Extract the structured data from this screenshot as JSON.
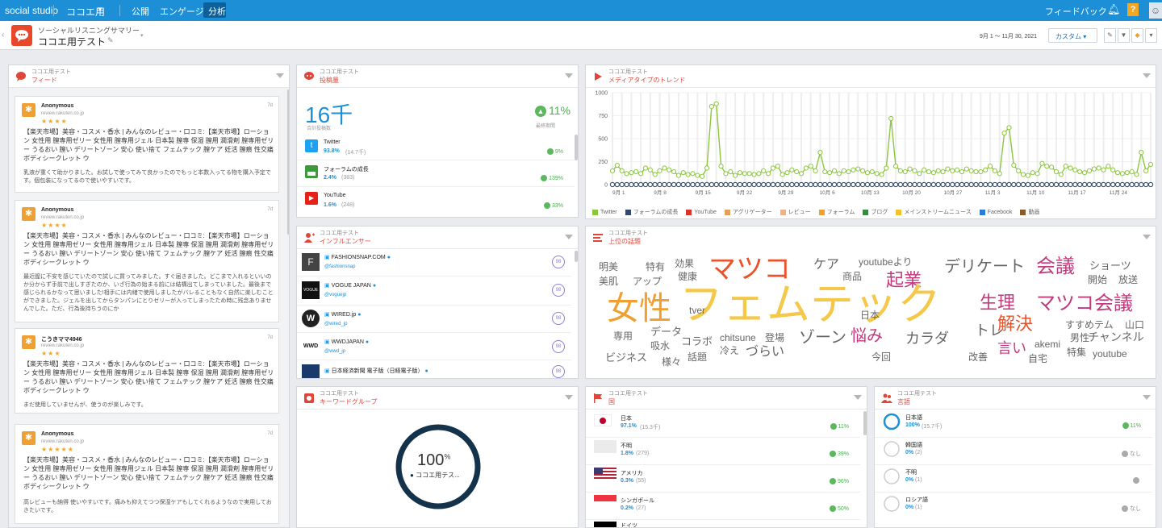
{
  "topbar": {
    "app": "social studio",
    "workspace": "ココエ用",
    "tabs": [
      "公開",
      "エンゲージ",
      "分析"
    ],
    "feedback": "フィードバック",
    "help": "?"
  },
  "header": {
    "subtitle": "ソーシャルリスニングサマリー",
    "title": "ココエ用テスト",
    "date_range": "9月 1 ～ 11月 30, 2021",
    "custom": "カスタム"
  },
  "widget_subtitle": "ココエ用テスト",
  "feed": {
    "title": "フィード",
    "items": [
      {
        "name": "Anonymous",
        "source": "review.rakuten.co.jp",
        "stars": "★★★★",
        "time": "7d",
        "body": "【楽天市場】美容・コスメ・香水 | みんなのレビュー・口コミ:【楽天市場】ローション 女性用 膣専用ゼリー 女性用 膣専用ジェル 日本製 膣専 保湿 膣用 潤滑剤 膣専用ゼリー うるおい 膣い デリートゾーン 安心 使い捨て フェムテック 膣ケア 妊活 膣痕 性交痛 ボディシークレット ウ",
        "note": "乳液が重くて助かりました。お試しで使ってみて良かったのでもっと本数入ってる物を購入予定です。個包装になってるので使いやすいです。"
      },
      {
        "name": "Anonymous",
        "source": "review.rakuten.co.jp",
        "stars": "★★★★",
        "time": "7d",
        "body": "【楽天市場】美容・コスメ・香水 | みんなのレビュー・口コミ:【楽天市場】ローション 女性用 膣専用ゼリー 女性用 膣専用ジェル 日本製 膣専 保湿 膣用 潤滑剤 膣専用ゼリー うるおい 膣い デリートゾーン 安心 使い捨て フェムテック 膣ケア 妊活 膣痕 性交痛 ボディシークレット ウ",
        "note": "最近膣に不安を感じていたので試しに買ってみました。すぐ届きました。どこまで入れるといいのか分からず手前で出しすぎたのか、いざ行為の始まる前には結構出てしまっていました。最後まで感じられるかなって思いました!相手には内緒で使用しましたがバレることもなく自然に楽しむことができました。ジェルを出してからタンパンにとりゼリーが入ってしまったため時に残念ありませんでした。ただ、行為後持ちうのにか"
      },
      {
        "name": "こうきママ4946",
        "source": "review.rakuten.co.jp",
        "stars": "★★★",
        "time": "7d",
        "body": "【楽天市場】美容・コスメ・香水 | みんなのレビュー・口コミ:【楽天市場】ローション 女性用 膣専用ゼリー 女性用 膣専用ジェル 日本製 膣専 保湿 膣用 潤滑剤 膣専用ゼリー うるおい 膣い デリートゾーン 安心 使い捨て フェムテック 膣ケア 妊活 膣痕 性交痛 ボディシークレット ウ",
        "note": "まだ使用していませんが、使うのが楽しみです。"
      },
      {
        "name": "Anonymous",
        "source": "review.rakuten.co.jp",
        "stars": "★★★★★",
        "time": "7d",
        "body": "【楽天市場】美容・コスメ・香水 | みんなのレビュー・口コミ:【楽天市場】ローション 女性用 膣専用ゼリー 女性用 膣専用ジェル 日本製 膣専 保湿 膣用 潤滑剤 膣専用ゼリー うるおい 膣い デリートゾーン 安心 使い捨て フェムテック 膣ケア 妊活 膣痕 性交痛 ボディシークレット ウ",
        "note": "高レビューも納得 使いやすいです。痛みも抑えてつつ保湿ケアもしてくれるようなので実用しておきたいです。"
      }
    ]
  },
  "volume": {
    "title": "投稿量",
    "total": "16千",
    "total_label": "合計投稿数",
    "change": "11%",
    "change_label": "最終期間",
    "sources": [
      {
        "name": "Twitter",
        "pct": "93.8%",
        "count": "(14.7千)",
        "change": "9%",
        "color": "#1da1f2"
      },
      {
        "name": "フォーラムの成長",
        "pct": "2.4%",
        "count": "(383)",
        "change": "139%",
        "color": "#3c9a3c"
      },
      {
        "name": "YouTube",
        "pct": "1.6%",
        "count": "(248)",
        "change": "33%",
        "color": "#e62117"
      }
    ]
  },
  "trend": {
    "title": "メディアタイプのトレンド",
    "legend": [
      {
        "name": "Twitter",
        "color": "#8cc63f"
      },
      {
        "name": "フォーラムの成長",
        "color": "#2e4a6b"
      },
      {
        "name": "YouTube",
        "color": "#d9342b"
      },
      {
        "name": "アグリゲーター",
        "color": "#e0a060"
      },
      {
        "name": "レビュー",
        "color": "#f4b183"
      },
      {
        "name": "フォーラム",
        "color": "#f0a030"
      },
      {
        "name": "ブログ",
        "color": "#2f8f3a"
      },
      {
        "name": "メインストリームニュース",
        "color": "#f2c12e"
      },
      {
        "name": "Facebook",
        "color": "#2a7ad6"
      },
      {
        "name": "動画",
        "color": "#8b5a2b"
      }
    ]
  },
  "chart_data": {
    "type": "line",
    "title": "",
    "xlabel": "",
    "ylabel": "",
    "ylim": [
      0,
      1000
    ],
    "yticks": [
      0,
      250,
      500,
      750,
      1000
    ],
    "xticks": [
      "9月 1",
      "9月 8",
      "9月 15",
      "9月 22",
      "9月 29",
      "10月 6",
      "10月 13",
      "10月 20",
      "10月 27",
      "11月 3",
      "11月 10",
      "11月 17",
      "11月 24"
    ],
    "series": [
      {
        "name": "Twitter",
        "color": "#8cc63f",
        "values": [
          150,
          210,
          150,
          120,
          130,
          140,
          120,
          180,
          160,
          110,
          150,
          180,
          160,
          140,
          100,
          130,
          110,
          120,
          100,
          90,
          180,
          850,
          880,
          200,
          120,
          140,
          100,
          130,
          120,
          120,
          110,
          120,
          150,
          120,
          180,
          200,
          110,
          130,
          160,
          140,
          120,
          180,
          200,
          150,
          350,
          140,
          130,
          150,
          120,
          150,
          140,
          160,
          170,
          150,
          130,
          140,
          120,
          110,
          180,
          720,
          200,
          150,
          140,
          170,
          150,
          120,
          160,
          140,
          130,
          150,
          140,
          170,
          150,
          160,
          140,
          170,
          150,
          140,
          140,
          160,
          200,
          150,
          120,
          560,
          620,
          210,
          150,
          110,
          100,
          130,
          120,
          230,
          200,
          190,
          140,
          110,
          200,
          180,
          160,
          140,
          130,
          150,
          170,
          180,
          160,
          200,
          160,
          130,
          120,
          130,
          140,
          110,
          350,
          150,
          220
        ]
      },
      {
        "name": "フォーラムの成長",
        "color": "#2e4a6b",
        "values": [
          0,
          0,
          0,
          0,
          0,
          0,
          0,
          0,
          0,
          0,
          0,
          0,
          0,
          0,
          0,
          0,
          0,
          0,
          0,
          0,
          0,
          0,
          0,
          0,
          0,
          0,
          0,
          0,
          0,
          0,
          0,
          0,
          0,
          0,
          0,
          0,
          0,
          0,
          0,
          0,
          0,
          0,
          0,
          0,
          0,
          0,
          0,
          0,
          0,
          0,
          0,
          0,
          0,
          0,
          0,
          0,
          0,
          0,
          0,
          0,
          0,
          0,
          0,
          0,
          0,
          0,
          0,
          0,
          0,
          0,
          0,
          0,
          0,
          0,
          0,
          0,
          0,
          0,
          0,
          0,
          0,
          0,
          0,
          0,
          0,
          0,
          0,
          0,
          0,
          0,
          0,
          0,
          0,
          0,
          0,
          0,
          0,
          0,
          0,
          0,
          0,
          0,
          0,
          0,
          0,
          0,
          0,
          0,
          0,
          0,
          0,
          0,
          0,
          0,
          0
        ]
      },
      {
        "name": "YouTube",
        "color": "#8b5a2b",
        "values": [
          0,
          0,
          0,
          0,
          0,
          0,
          0,
          0,
          0,
          0,
          0,
          0,
          0,
          0,
          0,
          0,
          0,
          0,
          0,
          0,
          0,
          0,
          0,
          0,
          0,
          0,
          0,
          0,
          0,
          0,
          0,
          0,
          0,
          0,
          0,
          0,
          0,
          0,
          0,
          0,
          0,
          0,
          0,
          0,
          0,
          0,
          0,
          0,
          0,
          0,
          0,
          0,
          0,
          0,
          0,
          0,
          0,
          0,
          0,
          0,
          0,
          0,
          0,
          0,
          0,
          0,
          0,
          0,
          0,
          0,
          0,
          0,
          0,
          0,
          0,
          0,
          0,
          0,
          0,
          0,
          0,
          0,
          0,
          0,
          0,
          0,
          0,
          0,
          0,
          0,
          0,
          0,
          0,
          0,
          0,
          0,
          0,
          0,
          0,
          0,
          0,
          0,
          0,
          0,
          0,
          0,
          0,
          0,
          0,
          0,
          0,
          0,
          0,
          0,
          0
        ]
      }
    ]
  },
  "influencers": {
    "title": "インフルエンサー",
    "items": [
      {
        "name": "FASHIONSNAP.COM",
        "handle": "@fashionsnap",
        "score": "98"
      },
      {
        "name": "VOGUE JAPAN",
        "handle": "@voguejp",
        "score": "98"
      },
      {
        "name": "WIRED.jp",
        "handle": "@wired_jp",
        "score": "98"
      },
      {
        "name": "WWDJAPAN",
        "handle": "@wwd_jp",
        "score": "98"
      },
      {
        "name": "日本経済新聞 電子版（日経電子版）",
        "handle": "@nikkei",
        "score": "98"
      }
    ]
  },
  "topics": {
    "title": "上位の話題",
    "words": [
      {
        "text": "明美",
        "color": "#666",
        "size": 12
      },
      {
        "text": "特有",
        "color": "#666",
        "size": 12
      },
      {
        "text": "効果",
        "color": "#666",
        "size": 12
      },
      {
        "text": "マツコ",
        "color": "#e8532a",
        "size": 34
      },
      {
        "text": "ケア",
        "color": "#666",
        "size": 16
      },
      {
        "text": "youtubeより",
        "color": "#666",
        "size": 12
      },
      {
        "text": "デリケート",
        "color": "#666",
        "size": 20
      },
      {
        "text": "会議",
        "color": "#c2397d",
        "size": 24
      },
      {
        "text": "ショーツ",
        "color": "#666",
        "size": 13
      },
      {
        "text": "美肌",
        "color": "#666",
        "size": 12
      },
      {
        "text": "アップ",
        "color": "#666",
        "size": 12
      },
      {
        "text": "健康",
        "color": "#666",
        "size": 12
      },
      {
        "text": "商品",
        "color": "#666",
        "size": 12
      },
      {
        "text": "起業",
        "color": "#c2397d",
        "size": 22
      },
      {
        "text": "開始",
        "color": "#666",
        "size": 12
      },
      {
        "text": "放送",
        "color": "#666",
        "size": 12
      },
      {
        "text": "女性",
        "color": "#f0a030",
        "size": 40
      },
      {
        "text": "フェムテック",
        "color": "#f5c84a",
        "size": 54
      },
      {
        "text": "tver",
        "color": "#666",
        "size": 12
      },
      {
        "text": "生理",
        "color": "#c2397d",
        "size": 22
      },
      {
        "text": "マツコ会議",
        "color": "#c2397d",
        "size": 24
      },
      {
        "text": "日本",
        "color": "#666",
        "size": 12
      },
      {
        "text": "専用",
        "color": "#666",
        "size": 12
      },
      {
        "text": "データ",
        "color": "#666",
        "size": 13
      },
      {
        "text": "トレ",
        "color": "#666",
        "size": 18
      },
      {
        "text": "解決",
        "color": "#e8532a",
        "size": 22
      },
      {
        "text": "すすめ",
        "color": "#666",
        "size": 12
      },
      {
        "text": "テム",
        "color": "#666",
        "size": 12
      },
      {
        "text": "山口",
        "color": "#666",
        "size": 12
      },
      {
        "text": "コラボ",
        "color": "#666",
        "size": 13
      },
      {
        "text": "chitsune",
        "color": "#666",
        "size": 12
      },
      {
        "text": "登場",
        "color": "#666",
        "size": 12
      },
      {
        "text": "ゾーン",
        "color": "#666",
        "size": 20
      },
      {
        "text": "悩み",
        "color": "#c2397d",
        "size": 20
      },
      {
        "text": "カラダ",
        "color": "#666",
        "size": 18
      },
      {
        "text": "男性",
        "color": "#666",
        "size": 12
      },
      {
        "text": "チャンネル",
        "color": "#666",
        "size": 14
      },
      {
        "text": "吸水",
        "color": "#666",
        "size": 12
      },
      {
        "text": "冷え",
        "color": "#666",
        "size": 12
      },
      {
        "text": "言い",
        "color": "#c2397d",
        "size": 18
      },
      {
        "text": "akemi",
        "color": "#666",
        "size": 12
      },
      {
        "text": "特集",
        "color": "#666",
        "size": 12
      },
      {
        "text": "youtube",
        "color": "#666",
        "size": 12
      },
      {
        "text": "ビジネス",
        "color": "#666",
        "size": 13
      },
      {
        "text": "様々",
        "color": "#666",
        "size": 12
      },
      {
        "text": "話題",
        "color": "#666",
        "size": 12
      },
      {
        "text": "づらい",
        "color": "#666",
        "size": 16
      },
      {
        "text": "今回",
        "color": "#666",
        "size": 12
      },
      {
        "text": "改善",
        "color": "#666",
        "size": 12
      },
      {
        "text": "自宅",
        "color": "#666",
        "size": 12
      }
    ]
  },
  "keywords": {
    "title": "キーワードグループ",
    "pct": "100",
    "pct_unit": "%",
    "label": "ココエ用テス..."
  },
  "countries": {
    "title": "国",
    "items": [
      {
        "name": "日本",
        "pct": "97.1%",
        "count": "(15.3千)",
        "change": "11%"
      },
      {
        "name": "不明",
        "pct": "1.8%",
        "count": "(279)",
        "change": "39%"
      },
      {
        "name": "アメリカ",
        "pct": "0.3%",
        "count": "(55)",
        "change": "96%"
      },
      {
        "name": "シンガポール",
        "pct": "0.2%",
        "count": "(27)",
        "change": "50%"
      },
      {
        "name": "ドイツ",
        "pct": "",
        "count": "",
        "change": ""
      }
    ]
  },
  "languages": {
    "title": "言語",
    "items": [
      {
        "name": "日本語",
        "pct": "100%",
        "count": "(15.7千)",
        "change": "11%",
        "full": true
      },
      {
        "name": "韓国語",
        "pct": "0%",
        "count": "(2)",
        "change": "なし",
        "full": false
      },
      {
        "name": "不明",
        "pct": "0%",
        "count": "(1)",
        "change": "",
        "full": false
      },
      {
        "name": "ロシア語",
        "pct": "0%",
        "count": "(1)",
        "change": "なし",
        "full": false
      }
    ]
  }
}
